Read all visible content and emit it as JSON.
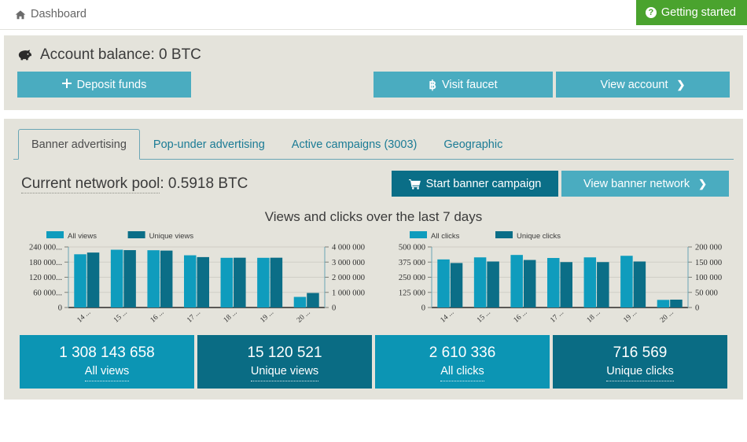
{
  "topbar": {
    "breadcrumb": "Dashboard",
    "home_icon": "home-icon",
    "getting_started": "Getting started",
    "help_icon": "question-circle-icon",
    "green": "#4aa32e"
  },
  "account": {
    "balance_text": "Account balance: 0 BTC",
    "piggy_icon": "piggy-bank-icon",
    "deposit_label": "Deposit funds",
    "deposit_icon": "plus-icon",
    "faucet_label": "Visit faucet",
    "faucet_icon": "bitcoin-icon",
    "view_account_label": "View account",
    "view_account_icon": "chevron-right-icon",
    "panel_bg": "#e4e3db",
    "teal": "#4aacc0"
  },
  "tabs": [
    {
      "label": "Banner advertising",
      "active": true
    },
    {
      "label": "Pop-under advertising",
      "active": false
    },
    {
      "label": "Active campaigns (3003)",
      "active": false
    },
    {
      "label": "Geographic",
      "active": false
    }
  ],
  "pool": {
    "label": "Current network pool",
    "value": ": 0.5918 BTC",
    "start_campaign_label": "Start banner campaign",
    "start_campaign_icon": "shopping-cart-icon",
    "view_network_label": "View banner network",
    "view_network_icon": "chevron-right-icon",
    "dark_teal": "#0a6e87"
  },
  "section_title": "Views and clicks over the last 7 days",
  "stats": [
    {
      "value": "1 308 143 658",
      "label": "All views",
      "tone": "light"
    },
    {
      "value": "15 120 521",
      "label": "Unique views",
      "tone": "dark"
    },
    {
      "value": "2 610 336",
      "label": "All clicks",
      "tone": "light"
    },
    {
      "value": "716 569",
      "label": "Unique clicks",
      "tone": "dark"
    }
  ],
  "chart_data": [
    {
      "type": "bar",
      "title": "Views and clicks over the last 7 days",
      "id": "views-chart",
      "categories": [
        "14 ...",
        "15 ...",
        "16 ...",
        "17 ...",
        "18 ...",
        "19 ...",
        "20 ..."
      ],
      "series": [
        {
          "name": "All views",
          "color": "#0f9cbd",
          "axis": "left",
          "values": [
            211000,
            229000,
            227000,
            207000,
            197000,
            197000,
            42000
          ]
        },
        {
          "name": "Unique views",
          "color": "#0b6e87",
          "axis": "right",
          "values": [
            3630000,
            3790000,
            3760000,
            3330000,
            3290000,
            3290000,
            960000
          ]
        }
      ],
      "left_axis": {
        "ticks": [
          "0",
          "60 000...",
          "120 000...",
          "180 000...",
          "240 000..."
        ],
        "min": 0,
        "max": 240000
      },
      "right_axis": {
        "ticks": [
          "0",
          "1 000 000",
          "2 000 000",
          "3 000 000",
          "4 000 000"
        ],
        "min": 0,
        "max": 4000000
      },
      "legend": [
        "All views",
        "Unique views"
      ],
      "legend_position": "top-left",
      "grid": true
    },
    {
      "type": "bar",
      "title": "Views and clicks over the last 7 days",
      "id": "clicks-chart",
      "categories": [
        "14 ...",
        "15 ...",
        "16 ...",
        "17 ...",
        "18 ...",
        "19 ...",
        "20 ..."
      ],
      "series": [
        {
          "name": "All clicks",
          "color": "#0f9cbd",
          "axis": "left",
          "values": [
            397000,
            414000,
            434000,
            409000,
            414000,
            427000,
            63000
          ]
        },
        {
          "name": "Unique clicks",
          "color": "#0b6e87",
          "axis": "right",
          "values": [
            147000,
            152000,
            157000,
            150000,
            150000,
            152000,
            26000
          ]
        }
      ],
      "left_axis": {
        "ticks": [
          "0",
          "125 000",
          "250 000",
          "375 000",
          "500 000"
        ],
        "min": 0,
        "max": 500000
      },
      "right_axis": {
        "ticks": [
          "0",
          "50 000",
          "100 000",
          "150 000",
          "200 000"
        ],
        "min": 0,
        "max": 200000
      },
      "legend": [
        "All clicks",
        "Unique clicks"
      ],
      "legend_position": "top-left",
      "grid": true
    }
  ]
}
